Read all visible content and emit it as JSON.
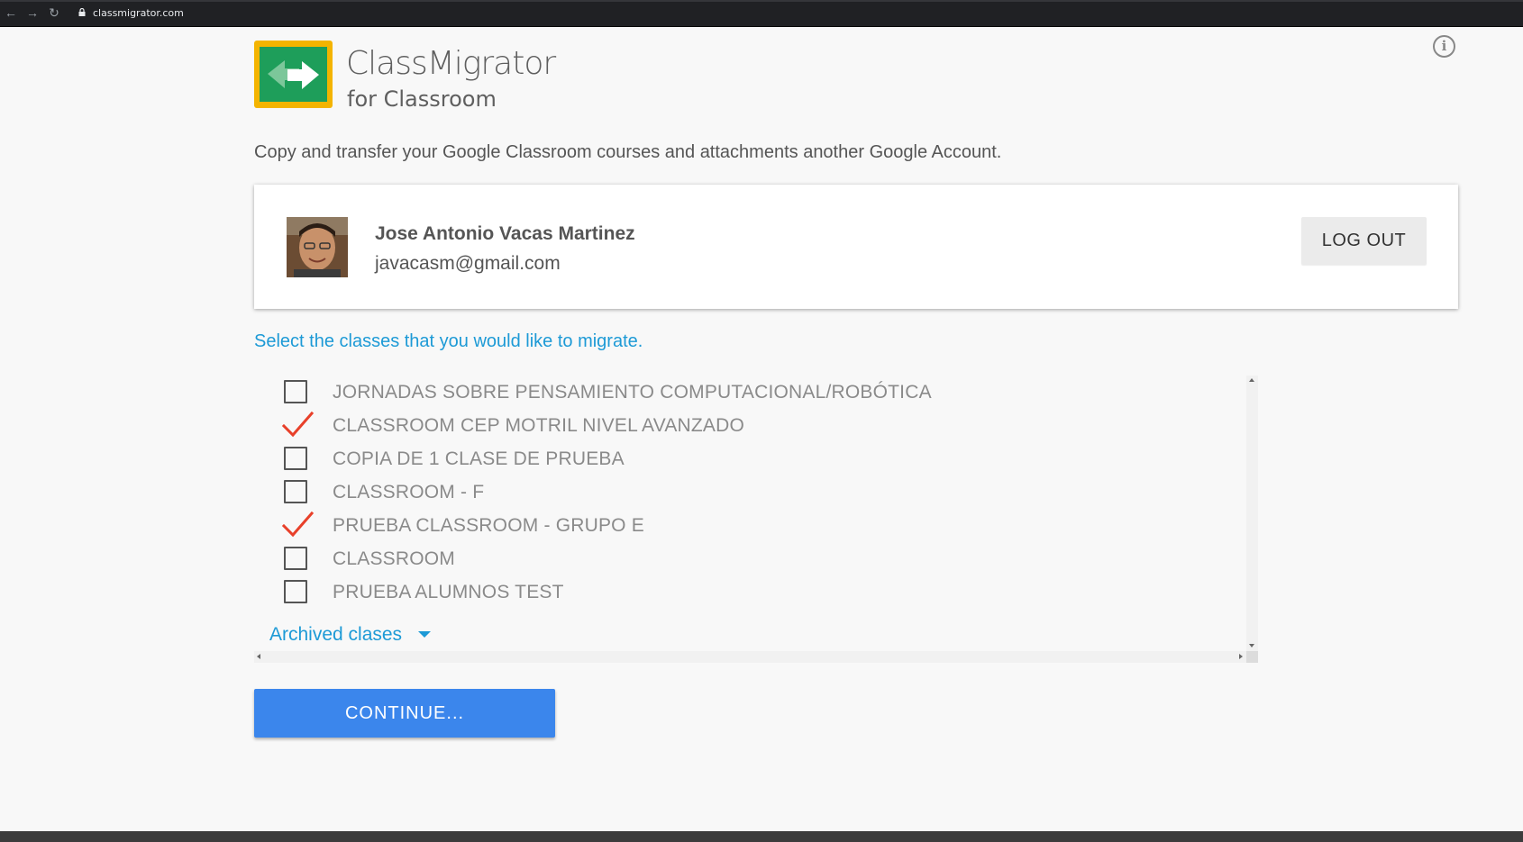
{
  "browser": {
    "url": "classmigrator.com"
  },
  "brand": {
    "name": "ClassMigrator",
    "subtitle": "for Classroom",
    "logo_colors": {
      "frame": "#f4b400",
      "inner": "#1e9e5a"
    }
  },
  "tagline": "Copy and transfer your Google Classroom courses and attachments another Google Account.",
  "account": {
    "name": "Jose Antonio Vacas Martinez",
    "email": "javacasm@gmail.com",
    "logout_label": "LOG OUT"
  },
  "select_prompt": "Select the classes that you would like to migrate.",
  "classes": [
    {
      "label": "JORNADAS SOBRE PENSAMIENTO COMPUTACIONAL/ROBÓTICA",
      "checked": false
    },
    {
      "label": "CLASSROOM CEP MOTRIL NIVEL AVANZADO",
      "checked": true
    },
    {
      "label": "COPIA DE 1 CLASE DE PRUEBA",
      "checked": false
    },
    {
      "label": "CLASSROOM - F",
      "checked": false
    },
    {
      "label": "PRUEBA CLASSROOM - GRUPO E",
      "checked": true
    },
    {
      "label": "CLASSROOM",
      "checked": false
    },
    {
      "label": "PRUEBA ALUMNOS TEST",
      "checked": false
    }
  ],
  "archived_label": "Archived clases",
  "continue_label": "CONTINUE...",
  "colors": {
    "accent_blue": "#1d9ad6",
    "button_blue": "#3b86ec",
    "check_red": "#e8402a"
  }
}
